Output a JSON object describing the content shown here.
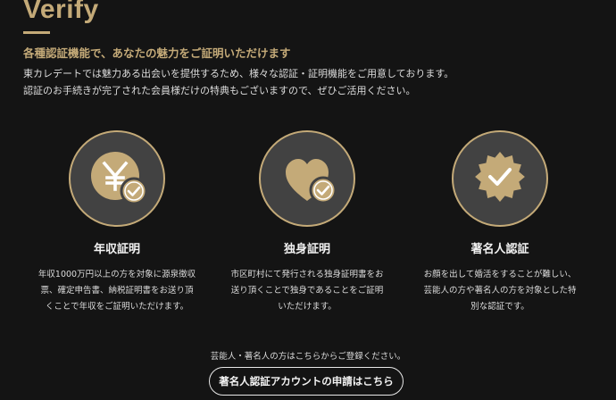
{
  "header": {
    "title": "Verify",
    "subtitle": "各種認証機能で、あなたの魅力をご証明いただけます",
    "description_line1": "東カレデートでは魅力ある出会いを提供するため、様々な認証・証明機能をご用意しております。",
    "description_line2": "認証のお手続きが完了された会員様だけの特典もございますので、ぜひご活用ください。"
  },
  "colors": {
    "accent": "#c4aa78",
    "background": "#141414",
    "circle": "#424242"
  },
  "cards": [
    {
      "icon": "yen-coin-check-icon",
      "title": "年収証明",
      "lines": [
        "年収1000万円以上の方を対象に源泉徴収",
        "票、確定申告書、納税証明書をお送り頂",
        "くことで年収をご証明いただけます。"
      ]
    },
    {
      "icon": "heart-check-icon",
      "title": "独身証明",
      "lines": [
        "市区町村にて発行される独身証明書をお",
        "送り頂くことで独身であることをご証明",
        "いただけます。"
      ]
    },
    {
      "icon": "verified-badge-icon",
      "title": "著名人認証",
      "lines": [
        "お顔を出して婚活をすることが難しい、",
        "芸能人の方や著名人の方を対象とした特",
        "別な認証です。"
      ]
    }
  ],
  "footer": {
    "note": "芸能人・著名人の方はこちらからご登録ください。",
    "cta_label": "著名人認証アカウントの申請はこちら"
  }
}
